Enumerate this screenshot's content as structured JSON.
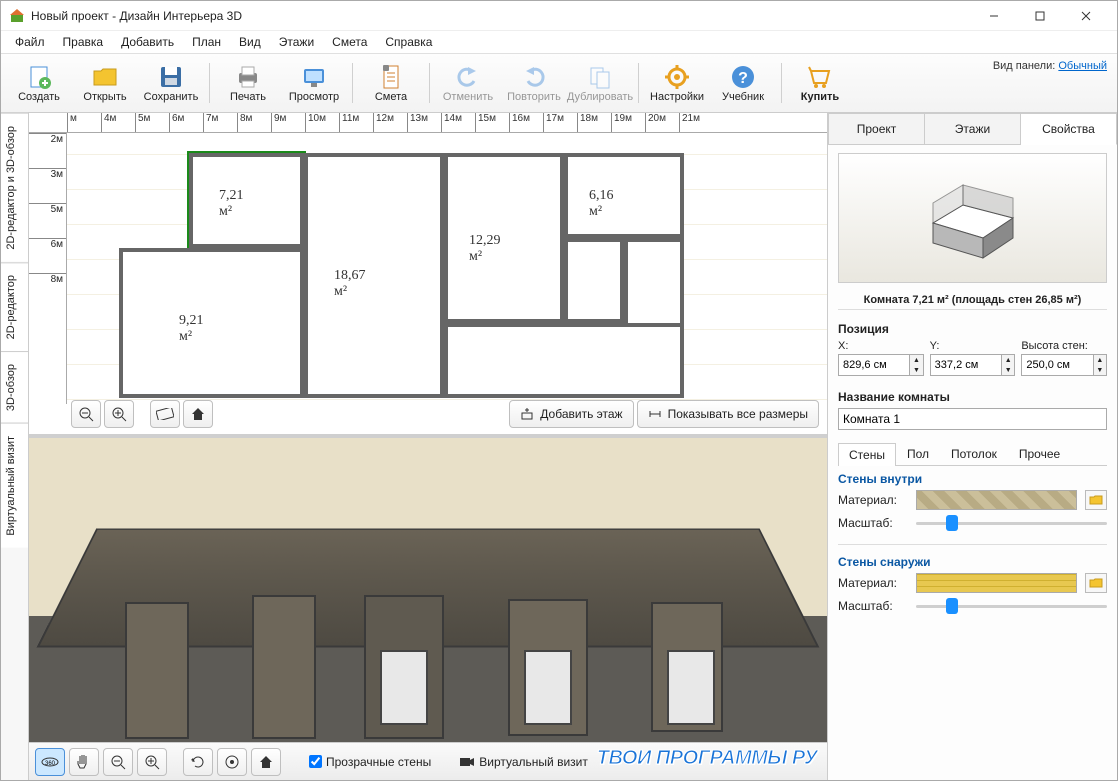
{
  "window": {
    "title": "Новый проект - Дизайн Интерьера 3D"
  },
  "menu": [
    "Файл",
    "Правка",
    "Добавить",
    "План",
    "Вид",
    "Этажи",
    "Смета",
    "Справка"
  ],
  "toolbar": {
    "create": "Создать",
    "open": "Открыть",
    "save": "Сохранить",
    "print": "Печать",
    "preview": "Просмотр",
    "estimate": "Смета",
    "undo": "Отменить",
    "redo": "Повторить",
    "duplicate": "Дублировать",
    "settings": "Настройки",
    "tutorial": "Учебник",
    "buy": "Купить",
    "viewpanel_label": "Вид панели:",
    "viewpanel_link": "Обычный"
  },
  "vtabs": [
    "2D-редактор и 3D-обзор",
    "2D-редактор",
    "3D-обзор",
    "Виртуальный визит"
  ],
  "ruler_h": [
    "м",
    "4м",
    "5м",
    "6м",
    "7м",
    "8м",
    "9м",
    "10м",
    "11м",
    "12м",
    "13м",
    "14м",
    "15м",
    "16м",
    "17м",
    "18м",
    "19м",
    "20м",
    "21м"
  ],
  "ruler_v": [
    "2м",
    "3м",
    "5м",
    "6м",
    "8м"
  ],
  "rooms": {
    "r1": "7,21 м²",
    "r2": "6,16 м²",
    "r3": "12,29 м²",
    "r4": "18,67 м²",
    "r5": "9,21 м²"
  },
  "plan_buttons": {
    "add_floor": "Добавить этаж",
    "show_dims": "Показывать все размеры"
  },
  "bottom": {
    "transparent": "Прозрачные стены",
    "vvisit": "Виртуальный визит"
  },
  "rtabs": [
    "Проект",
    "Этажи",
    "Свойства"
  ],
  "room_info": "Комната 7,21 м²  (площадь стен 26,85 м²)",
  "position": {
    "label": "Позиция",
    "x_label": "X:",
    "y_label": "Y:",
    "h_label": "Высота стен:",
    "x": "829,6 см",
    "y": "337,2 см",
    "h": "250,0 см"
  },
  "name": {
    "label": "Название комнаты",
    "value": "Комната 1"
  },
  "subtabs": [
    "Стены",
    "Пол",
    "Потолок",
    "Прочее"
  ],
  "walls_in": {
    "title": "Стены внутри",
    "material": "Материал:",
    "scale": "Масштаб:"
  },
  "walls_out": {
    "title": "Стены снаружи",
    "material": "Материал:",
    "scale": "Масштаб:"
  },
  "watermark": "ТВОИ ПРОГРАММЫ РУ"
}
